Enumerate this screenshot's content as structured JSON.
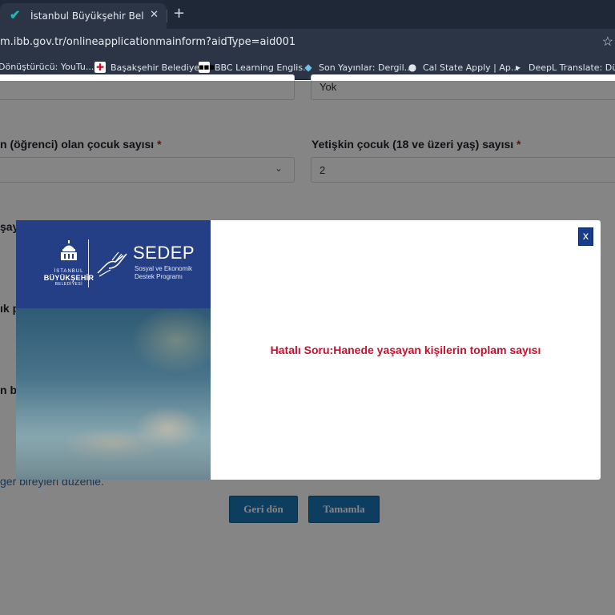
{
  "browser": {
    "tab_title": "İstanbul Büyükşehir Belediyesi S",
    "tab_close": "✕",
    "new_tab": "+",
    "url": "m.ibb.gov.tr/onlineapplicationmainform?aidType=aid001",
    "bookmarks": [
      {
        "label": "Dönüştürücü: YouTu...",
        "icon": "bookmark-icon"
      },
      {
        "label": "Başakşehir Belediye...",
        "icon": "municipality-icon"
      },
      {
        "label": "BBC Learning Englis...",
        "icon": "bbc-icon"
      },
      {
        "label": "Son Yayınlar: Dergil...",
        "icon": "journal-icon"
      },
      {
        "label": "Cal State Apply | Ap...",
        "icon": "globe-icon"
      },
      {
        "label": "DeepL Translate: Dü...",
        "icon": "deepl-icon"
      }
    ]
  },
  "form": {
    "field_top_right_value": "Yok",
    "label_students": "n (öğrenci) olan çocuk sayısı",
    "label_adult_children": "Yetişkin çocuk (18 ve üzeri yaş) sayısı",
    "required_mark": "*",
    "adult_children_value": "2",
    "partial_label_1": "şay",
    "partial_label_2": "ık p",
    "partial_label_3": "n ba",
    "link_text": "ger bireyleri düzenle.",
    "back_button": "Geri dön",
    "finish_button": "Tamamla"
  },
  "modal": {
    "brand_name": "SEDEP",
    "brand_sub1": "Sosyal ve Ekonomik",
    "brand_sub2": "Destek Programı",
    "logo_line1": "İSTANBUL",
    "logo_line2": "BÜYÜKŞEHİR",
    "logo_line3": "BELEDİYESİ",
    "close_label": "x",
    "message": "Hatalı Soru:Hanede yaşayan kişilerin toplam sayısı",
    "colors": {
      "brand_blue": "#253f86",
      "error_red": "#c8102e",
      "button_blue": "#1a78b8"
    }
  }
}
